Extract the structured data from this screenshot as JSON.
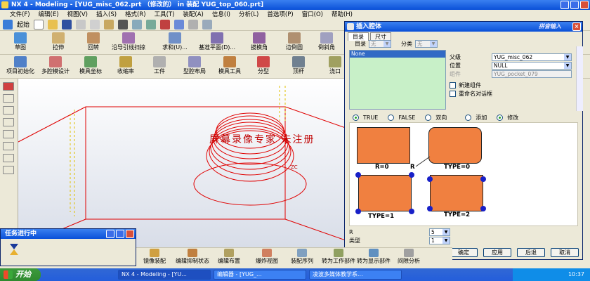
{
  "window": {
    "title": "NX 4 - Modeling - [YUG_misc_062.prt （修改的） in 装配 YUG_top_060.prt]"
  },
  "menu": [
    "文件(F)",
    "编辑(E)",
    "视图(V)",
    "插入(S)",
    "格式(R)",
    "工具(T)",
    "装配(A)",
    "信息(I)",
    "分析(L)",
    "首选项(P)",
    "窗口(O)",
    "帮助(H)"
  ],
  "toolbar1": {
    "start_label": "起始"
  },
  "toolbar2": [
    "草图",
    "拉伸",
    "回转",
    "沿导引线扫掠",
    "求和(U)...",
    "基准平面(D)...",
    "拔模角",
    "边倒圆",
    "倒斜角"
  ],
  "toolbar3": [
    "项目初始化",
    "多腔模设计",
    "模具坐标",
    "收缩率",
    "工件",
    "型腔布局",
    "模具工具",
    "分型",
    "顶杆",
    "浇口"
  ],
  "dialog": {
    "title": "插入腔体",
    "tabs": [
      "目录",
      "尺寸"
    ],
    "catalog_label": "目录",
    "catalog_value": "无",
    "category_label": "分类",
    "category_value": "无",
    "list_selected": "None",
    "parent_label": "父级",
    "parent_value": "YUG_misc_062",
    "position_label": "位置",
    "position_value": "NULL",
    "component_label": "组件",
    "component_value": "YUG_pocket_079",
    "new_component": "新建组件",
    "rename_dialog": "重命名对话框",
    "radios": [
      "TRUE",
      "FALSE",
      "双向",
      "添加",
      "修改"
    ],
    "preview_labels": [
      "R=0",
      "R",
      "TYPE=0",
      "TYPE=1",
      "TYPE=2"
    ],
    "r_label": "R",
    "r_value": "5",
    "type_label": "类型",
    "type_value": "1",
    "ok": "确定",
    "apply": "应用",
    "back": "后退",
    "cancel": "取消",
    "watermark": "拼音输入"
  },
  "viewport": {
    "watermark": "屏幕录像专家 未注册",
    "axis_label": "ZC"
  },
  "progress": {
    "title": "任务进行中"
  },
  "bottom_toolbar": [
    "镜像装配",
    "编辑抑制状态",
    "编辑布置",
    "爆炸视图",
    "装配序列",
    "转为工作部件",
    "转为显示部件",
    "间隙分析"
  ],
  "taskbar": {
    "start": "开始",
    "tasks": [
      "NX 4 - Modeling - [YU...",
      "编辑器 - [YUG_...",
      "凌波多媒体教学系..."
    ],
    "clock": "10:37"
  }
}
